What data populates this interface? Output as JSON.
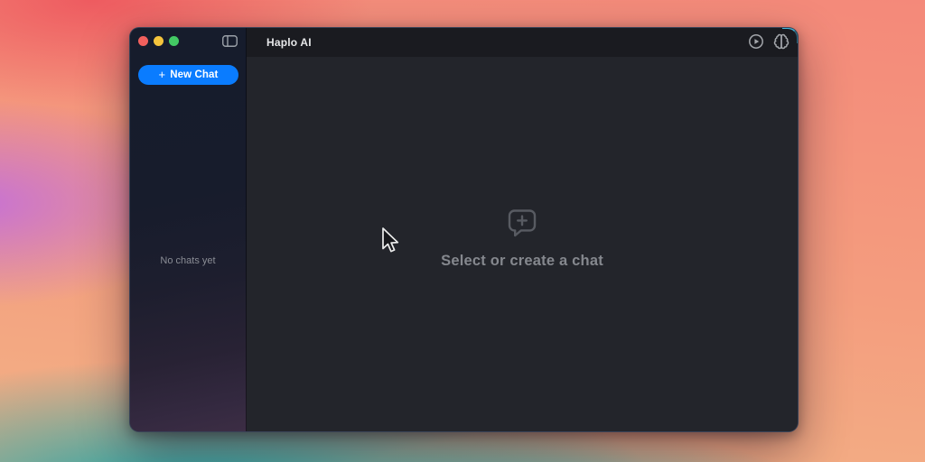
{
  "window": {
    "title": "Haplo AI",
    "traffic_lights": {
      "close_color": "#f2605d",
      "minimize_color": "#f5c43c",
      "zoom_color": "#43c964"
    }
  },
  "titlebar": {
    "title": "Haplo AI",
    "icons": [
      "sidebar-toggle",
      "play-circle",
      "brain"
    ]
  },
  "sidebar": {
    "new_chat_button": {
      "plus": "+",
      "label": "New Chat",
      "color": "#0a7cff"
    },
    "empty_text": "No chats yet"
  },
  "main": {
    "empty_icon": "new-chat-bubble",
    "empty_title": "Select or create a chat"
  },
  "colors": {
    "accent_blue": "#0a7cff",
    "window_bg": "#23252b",
    "titlebar_bg": "#1a1b20",
    "sidebar_top": "#161c2c",
    "sidebar_bottom": "#3c2d44",
    "muted_text": "#85888e"
  }
}
